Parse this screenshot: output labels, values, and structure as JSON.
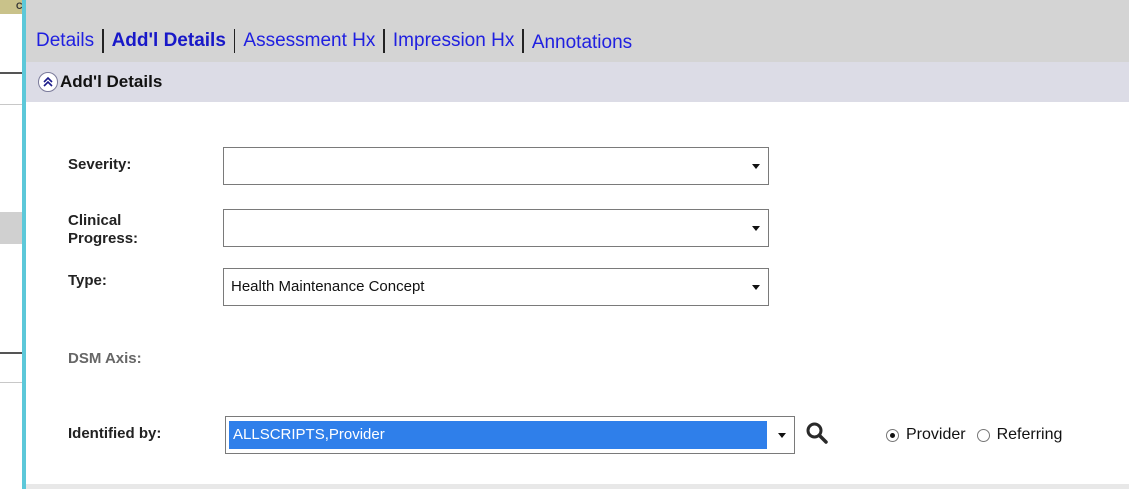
{
  "gutter": {
    "corner_text": "C:"
  },
  "tabs": [
    {
      "label": "Details",
      "active": false
    },
    {
      "label": "Add'l Details",
      "active": true
    },
    {
      "label": "Assessment Hx",
      "active": false
    },
    {
      "label": "Impression Hx",
      "active": false
    },
    {
      "label": "Annotations",
      "active": false
    }
  ],
  "section": {
    "title": "Add'l Details",
    "icon": "collapse-up-icon"
  },
  "fields": {
    "severity": {
      "label": "Severity:",
      "value": ""
    },
    "clinical_progress": {
      "label_line1": "Clinical",
      "label_line2": "Progress:",
      "value": ""
    },
    "type": {
      "label": "Type:",
      "value": "Health Maintenance Concept"
    },
    "dsm_axis": {
      "label": "DSM Axis:"
    },
    "identified_by": {
      "label": "Identified by:",
      "value": "ALLSCRIPTS,Provider"
    }
  },
  "identified_by_options": {
    "provider": {
      "label": "Provider",
      "selected": true
    },
    "referring": {
      "label": "Referring",
      "selected": false
    }
  },
  "icons": {
    "search": "search-icon",
    "dropdown": "chevron-down-icon"
  },
  "colors": {
    "accent_bar": "#5cc8d9",
    "tab_link": "#2020e0",
    "selection": "#2f7fea"
  }
}
